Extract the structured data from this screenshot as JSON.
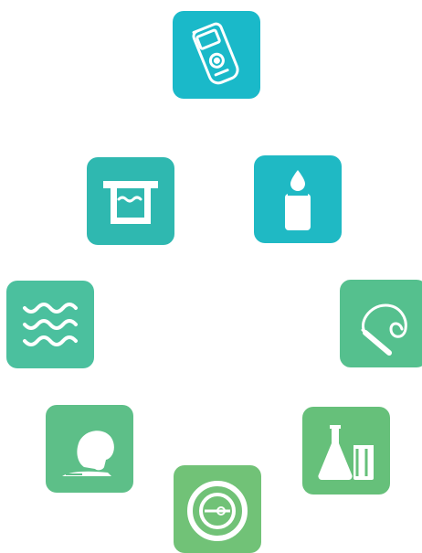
{
  "tiles": [
    {
      "id": "meter",
      "icon": "handheld-meter-icon",
      "color": "#1ab9c9"
    },
    {
      "id": "tank",
      "icon": "water-tank-icon",
      "color": "#2fb8b0"
    },
    {
      "id": "sample",
      "icon": "sample-bottle-icon",
      "color": "#1fb9c4"
    },
    {
      "id": "waves",
      "icon": "water-waves-icon",
      "color": "#4bc09e"
    },
    {
      "id": "probe",
      "icon": "cable-probe-icon",
      "color": "#55c08e"
    },
    {
      "id": "soil",
      "icon": "soil-sample-icon",
      "color": "#5dbf88"
    },
    {
      "id": "lab",
      "icon": "lab-glassware-icon",
      "color": "#66c07a"
    },
    {
      "id": "disc",
      "icon": "disc-filter-icon",
      "color": "#71c277"
    }
  ]
}
